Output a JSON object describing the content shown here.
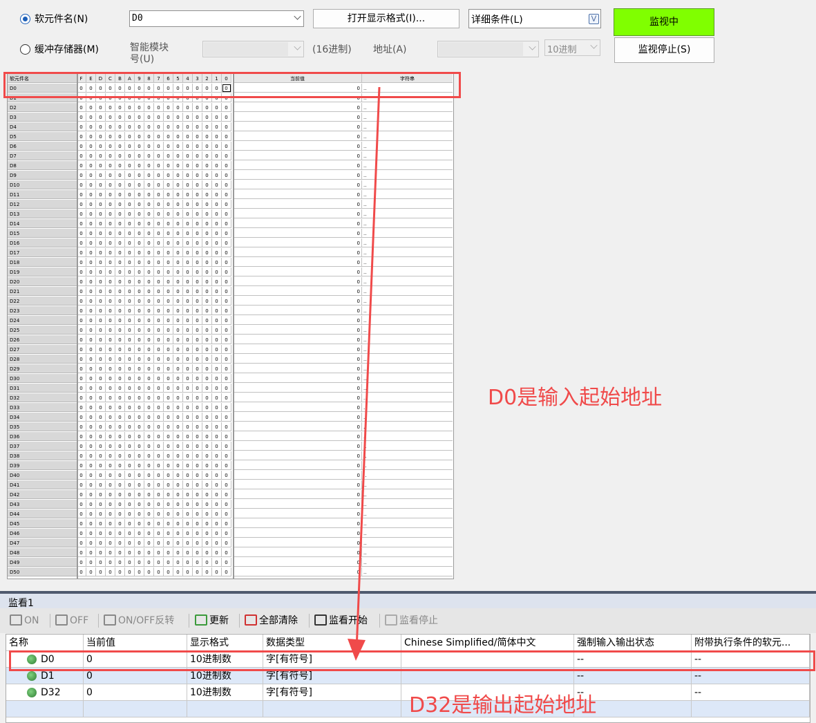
{
  "controls": {
    "device_name_label": "软元件名(N)",
    "device_name_value": "D0",
    "open_format_button": "打开显示格式(I)...",
    "detail_conditions": "详细条件(L)",
    "monitoring_button": "监视中",
    "buffer_memory_label": "缓冲存储器(M)",
    "smart_module_label_1": "智能模块",
    "smart_module_label_2": "号(U)",
    "hex_label": "(16进制)",
    "address_label": "地址(A)",
    "decimal_select": "10进制",
    "stop_monitor_button": "监视停止(S)"
  },
  "grid": {
    "headers": {
      "name": "软元件名",
      "current": "当前值",
      "string": "字符串"
    },
    "bit_headers": [
      "F",
      "E",
      "D",
      "C",
      "B",
      "A",
      "9",
      "8",
      "7",
      "6",
      "5",
      "4",
      "3",
      "2",
      "1",
      "0"
    ],
    "bit_value": "0",
    "current_value": "0",
    "string_value": "..",
    "rows": [
      "D0",
      "D1",
      "D2",
      "D3",
      "D4",
      "D5",
      "D6",
      "D7",
      "D8",
      "D9",
      "D10",
      "D11",
      "D12",
      "D13",
      "D14",
      "D15",
      "D16",
      "D17",
      "D18",
      "D19",
      "D20",
      "D21",
      "D22",
      "D23",
      "D24",
      "D25",
      "D26",
      "D27",
      "D28",
      "D29",
      "D30",
      "D31",
      "D32",
      "D33",
      "D34",
      "D35",
      "D36",
      "D37",
      "D38",
      "D39",
      "D40",
      "D41",
      "D42",
      "D43",
      "D44",
      "D45",
      "D46",
      "D47",
      "D48",
      "D49",
      "D50"
    ]
  },
  "watch": {
    "title": "监看1",
    "toolbar": [
      "ON",
      "OFF",
      "ON/OFF反转",
      "更新",
      "全部清除",
      "监看开始",
      "监看停止"
    ],
    "columns": [
      "名称",
      "当前值",
      "显示格式",
      "数据类型",
      "Chinese Simplified/简体中文",
      "强制输入输出状态",
      "附带执行条件的软元..."
    ],
    "rows": [
      {
        "name": "D0",
        "value": "0",
        "format": "10进制数",
        "type": "字[有符号]",
        "comment": "",
        "force": "--",
        "cond": "--"
      },
      {
        "name": "D1",
        "value": "0",
        "format": "10进制数",
        "type": "字[有符号]",
        "comment": "",
        "force": "--",
        "cond": "--"
      },
      {
        "name": "D32",
        "value": "0",
        "format": "10进制数",
        "type": "字[有符号]",
        "comment": "",
        "force": "--",
        "cond": "--"
      }
    ]
  },
  "annotations": {
    "input": "D0是输入起始地址",
    "output": "D32是输出起始地址",
    "color": "#f04a4a"
  }
}
